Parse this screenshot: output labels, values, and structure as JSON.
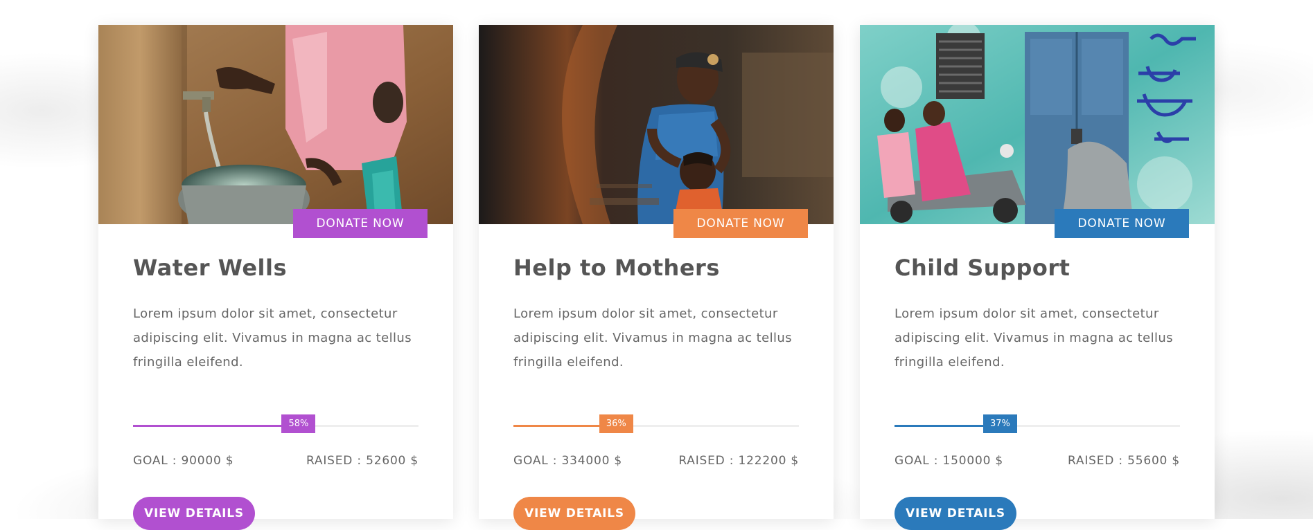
{
  "colors": {
    "purple": "#b150d0",
    "orange": "#ef8747",
    "blue": "#2b7abb",
    "heading": "#555555",
    "body_text": "#666666",
    "track": "#eeeeee"
  },
  "cards": [
    {
      "image": "woman-filling-bucket-at-water-tap-photo",
      "donate_label": "DONATE NOW",
      "title": "Water Wells",
      "description": "Lorem ipsum dolor sit amet, consectetur adipiscing elit. Vivamus in magna ac tellus fringilla eleifend.",
      "progress_percent": 58,
      "progress_label": "58%",
      "goal": "GOAL : 90000 $",
      "raised": "RAISED : 52600 $",
      "details_label": "VIEW DETAILS",
      "accent": "#b150d0"
    },
    {
      "image": "mother-braiding-child-hair-photo",
      "donate_label": "DONATE NOW",
      "title": "Help to Mothers",
      "description": "Lorem ipsum dolor sit amet, consectetur adipiscing elit. Vivamus in magna ac tellus fringilla eleifend.",
      "progress_percent": 36,
      "progress_label": "36%",
      "goal": "GOAL : 334000 $",
      "raised": "RAISED : 122200 $",
      "details_label": "VIEW DETAILS",
      "accent": "#ef8747"
    },
    {
      "image": "children-on-scooter-by-painted-wall-photo",
      "donate_label": "DONATE NOW",
      "title": "Child Support",
      "description": "Lorem ipsum dolor sit amet, consectetur adipiscing elit. Vivamus in magna ac tellus fringilla eleifend.",
      "progress_percent": 37,
      "progress_label": "37%",
      "goal": "GOAL : 150000 $",
      "raised": "RAISED : 55600 $",
      "details_label": "VIEW DETAILS",
      "accent": "#2b7abb"
    }
  ]
}
